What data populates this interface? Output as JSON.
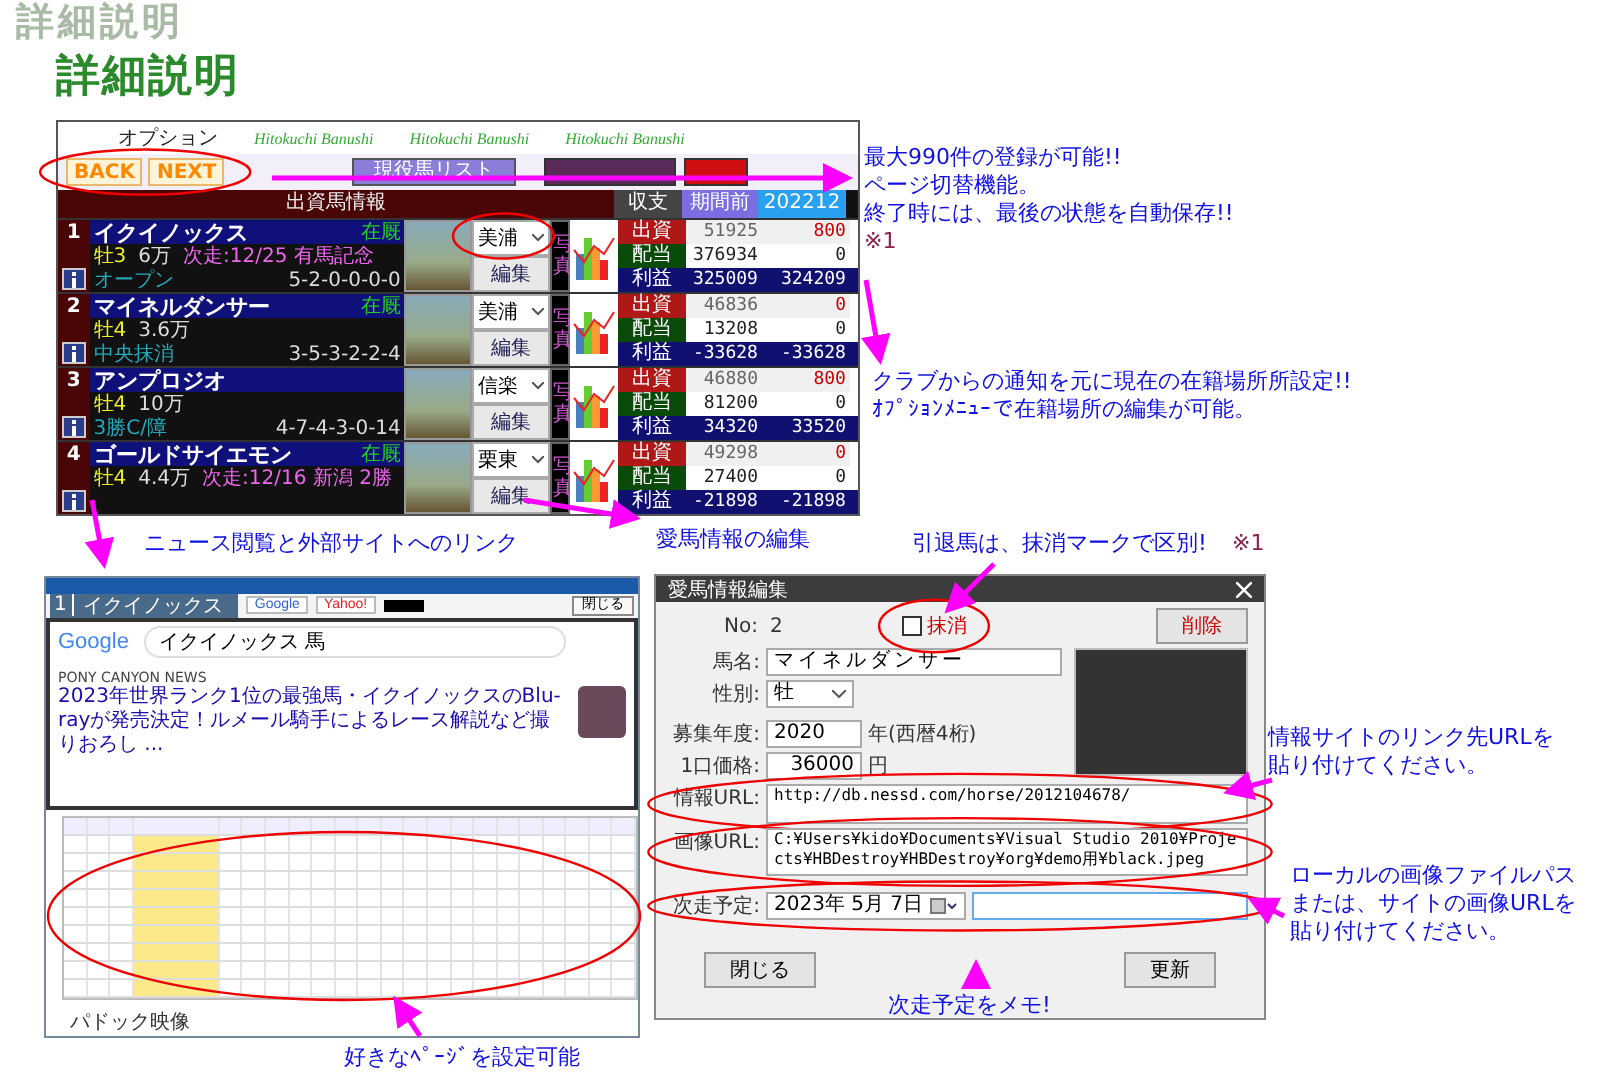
{
  "title": "詳細説明",
  "title_echo": "詳細説明",
  "app": {
    "menu": [
      "オプション"
    ],
    "logos": [
      "Hitokuchi Banushi",
      "Hitokuchi Banushi",
      "Hitokuchi Banushi"
    ],
    "nav": [
      "BACK",
      "NEXT"
    ],
    "list_button": "現役馬リスト",
    "panel_title": "出資馬情報",
    "finance_headers": [
      "収支",
      "期間前",
      "202212"
    ],
    "horses": [
      {
        "no": "1",
        "name": "イクイノックス",
        "status": "在厩",
        "sex": "牡3",
        "price": "6万",
        "next": "次走:12/25 有馬記念",
        "class": "オープン",
        "record": "5-2-0-0-0-0",
        "location": "美浦",
        "edit": "編集",
        "photo_label": "写真",
        "finance": [
          {
            "kind": "invest",
            "label": "出資",
            "values": [
              "51925",
              "800"
            ]
          },
          {
            "kind": "dividend",
            "label": "配当",
            "values": [
              "376934",
              "0"
            ]
          },
          {
            "kind": "profit",
            "label": "利益",
            "values": [
              "325009",
              "324209"
            ]
          }
        ]
      },
      {
        "no": "2",
        "name": "マイネルダンサー",
        "status": "在厩",
        "sex": "牡4",
        "price": "3.6万",
        "class": "中央抹消",
        "record": "3-5-3-2-2-4",
        "location": "美浦",
        "edit": "編集",
        "photo_label": "写真",
        "finance": [
          {
            "kind": "invest",
            "label": "出資",
            "values": [
              "46836",
              "0"
            ]
          },
          {
            "kind": "dividend",
            "label": "配当",
            "values": [
              "13208",
              "0"
            ]
          },
          {
            "kind": "profit",
            "label": "利益",
            "values": [
              "-33628",
              "-33628"
            ]
          }
        ]
      },
      {
        "no": "3",
        "name": "アンプロジオ",
        "sex": "牡4",
        "price": "10万",
        "class": "3勝C/障",
        "record": "4-7-4-3-0-14",
        "location": "信楽",
        "edit": "編集",
        "photo_label": "写真",
        "finance": [
          {
            "kind": "invest",
            "label": "出資",
            "values": [
              "46880",
              "800"
            ]
          },
          {
            "kind": "dividend",
            "label": "配当",
            "values": [
              "81200",
              "0"
            ]
          },
          {
            "kind": "profit",
            "label": "利益",
            "values": [
              "34320",
              "33520"
            ]
          }
        ]
      },
      {
        "no": "4",
        "name": "ゴールドサイエモン",
        "status": "在厩",
        "sex": "牡4",
        "price": "4.4万",
        "next": "次走:12/16 新潟 2勝",
        "location": "栗東",
        "edit": "編集",
        "photo_label": "写真",
        "finance": [
          {
            "kind": "invest",
            "label": "出資",
            "values": [
              "49298",
              "0"
            ]
          },
          {
            "kind": "dividend",
            "label": "配当",
            "values": [
              "27400",
              "0"
            ]
          },
          {
            "kind": "profit",
            "label": "利益",
            "values": [
              "-21898",
              "-21898"
            ]
          }
        ]
      }
    ]
  },
  "notes": {
    "register": [
      "最大990件の登録が可能!!",
      "ページ切替機能。",
      "終了時には、最後の状態を自動保存!!"
    ],
    "register_ref": "※1",
    "location": [
      "クラブからの通知を元に現在の在籍場所所設定!!",
      "ｵﾌﾟｼｮﾝﾒﾆｭｰで在籍場所の編集が可能。"
    ],
    "news": "ニュース閲覧と外部サイトへのリンク",
    "edit": "愛馬情報の編集",
    "retired": "引退馬は、抹消マークで区別!",
    "retired_ref": "※1",
    "pages": "好きなﾍﾟｰｼﾞを設定可能",
    "info_url": "情報サイトのリンク先URLを貼り付けてください。",
    "image_url": "ローカルの画像ファイルパスまたは、サイトの画像URLを貼り付けてください。",
    "memo": "次走予定をメモ!"
  },
  "browser": {
    "tab_no": "1",
    "horse": "イクイノックス",
    "links": [
      "Google",
      "Yahoo!"
    ],
    "close": "閉じる",
    "logo": "Google",
    "search_query": "イクイノックス 馬",
    "news_source": "PONY CANYON NEWS",
    "headline": "2023年世界ランク1位の最強馬・イクイノックスのBlu-rayが発売決定！ルメール騎手によるレース解説など撮りおろし ...",
    "section": "パドック映像"
  },
  "dialog": {
    "title": "愛馬情報編集",
    "no_label": "No:",
    "no": "2",
    "retired": {
      "label": "抹消",
      "checked": false
    },
    "delete": "削除",
    "name_label": "馬名:",
    "name": "マイネルダンサー",
    "sex_label": "性別:",
    "sex": "牡",
    "year_label": "募集年度:",
    "year": "2020",
    "year_hint": "年(西暦4桁)",
    "price_label": "1口価格:",
    "price": "36000",
    "price_unit": "円",
    "info_url_label": "情報URL:",
    "info_url": "http://db.nessd.com/horse/2012104678/",
    "image_url_label": "画像URL:",
    "image_url": "C:¥Users¥kido¥Documents¥Visual Studio 2010¥Projects¥HBDestroy¥HBDestroy¥org¥demo用¥black.jpeg",
    "next_label": "次走予定:",
    "next_date": "2023年 5月 7日",
    "close": "閉じる",
    "update": "更新"
  }
}
